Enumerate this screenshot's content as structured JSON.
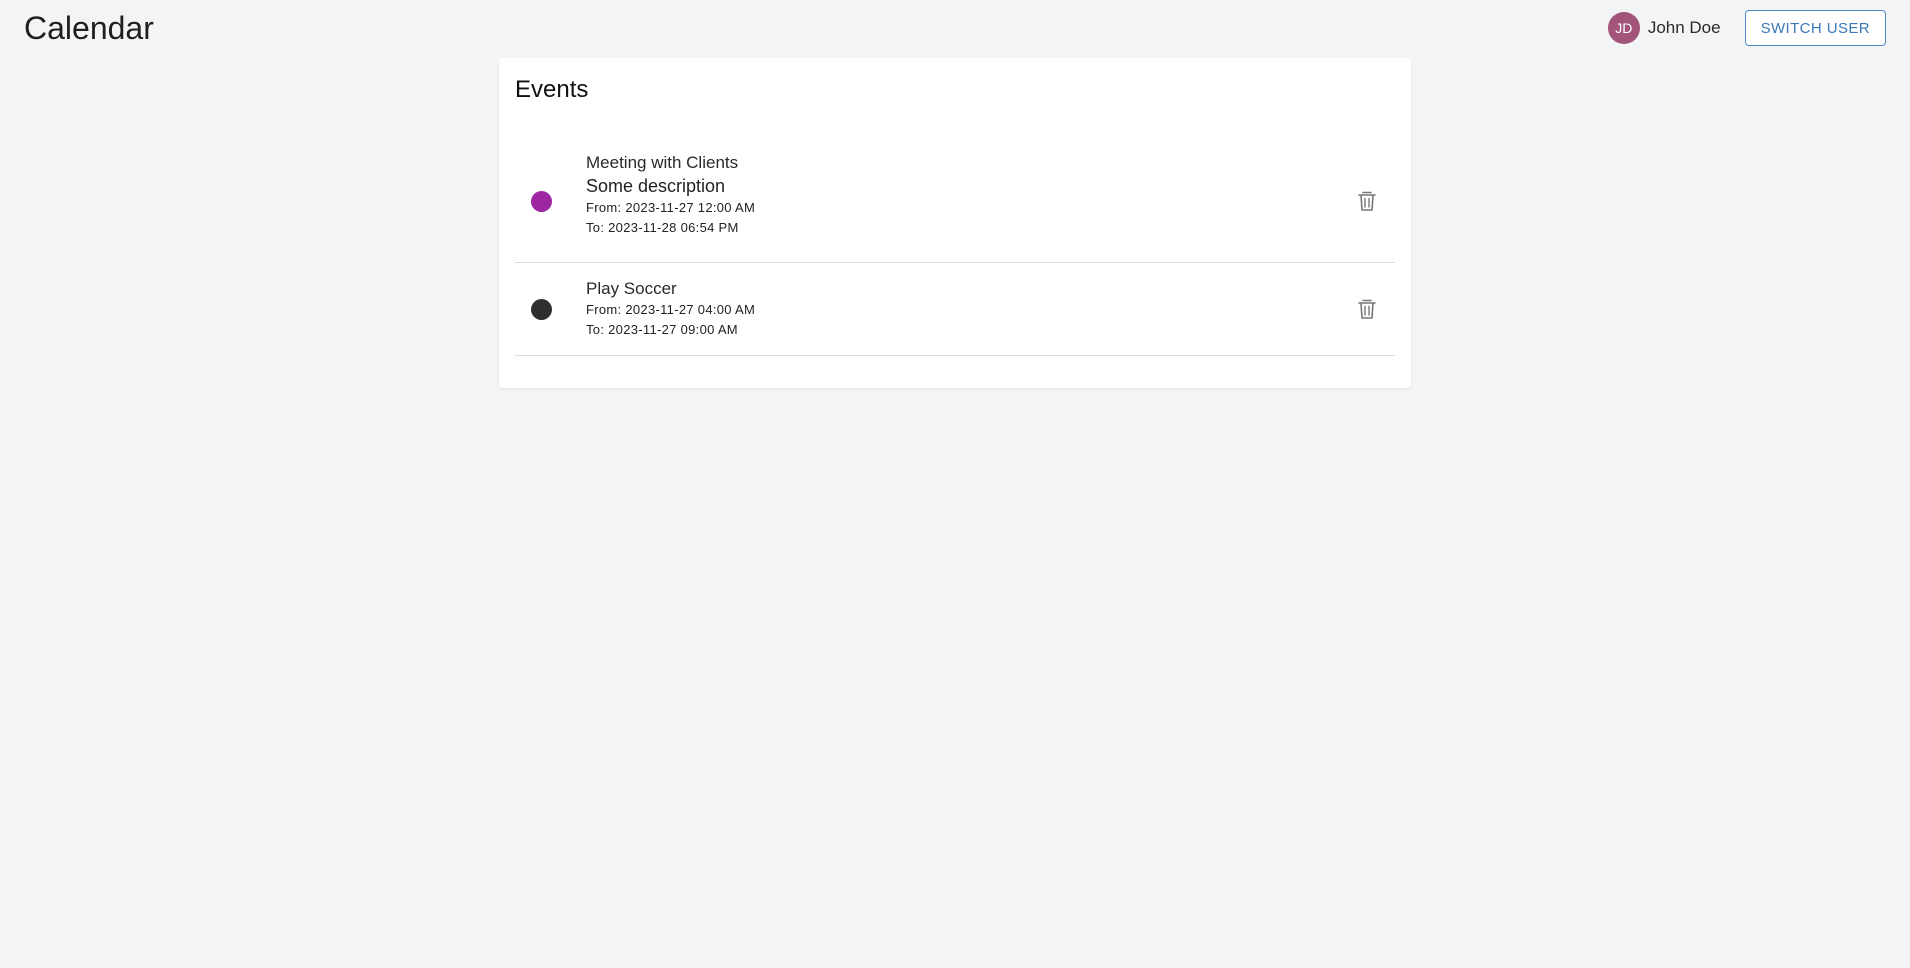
{
  "app": {
    "title": "Calendar"
  },
  "user": {
    "initials": "JD",
    "name": "John Doe",
    "avatar_color": "#a35479"
  },
  "header": {
    "switch_user_label": "SWITCH USER"
  },
  "events_card": {
    "title": "Events",
    "events": [
      {
        "title": "Meeting with Clients",
        "description": "Some description",
        "from": "From: 2023-11-27 12:00 AM",
        "to": "To: 2023-11-28 06:54 PM",
        "color": "#9c27a0",
        "delete_icon": "trash-icon"
      },
      {
        "title": "Play Soccer",
        "from": "From: 2023-11-27 04:00 AM",
        "to": "To: 2023-11-27 09:00 AM",
        "color": "#2f2f2f",
        "delete_icon": "trash-icon"
      }
    ]
  }
}
